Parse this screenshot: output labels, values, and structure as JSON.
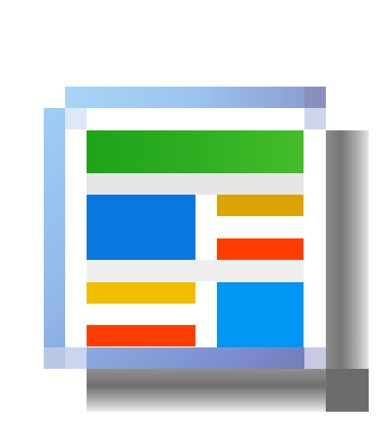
{
  "icon": {
    "name": "web-page-layout-icon",
    "colors": {
      "frame": "#92b8ea",
      "panel": "#ffffff",
      "header": "#2eae22",
      "blue_left": "#0a76df",
      "blue_right": "#0096f4",
      "orange": "#dca400",
      "yellow": "#f2be00",
      "red": "#ff3d00",
      "shadow": "#757575"
    }
  }
}
